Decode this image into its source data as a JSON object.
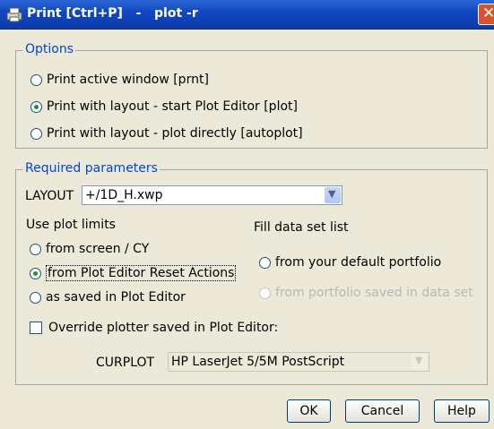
{
  "window": {
    "title": "Print [Ctrl+P]   -   plot -r",
    "icon": "print-icon",
    "close_icon": "close-icon"
  },
  "options": {
    "legend": "Options",
    "items": [
      {
        "label": "Print active window [prnt]",
        "checked": false
      },
      {
        "label": "Print with layout - start Plot Editor [plot]",
        "checked": true
      },
      {
        "label": "Print with layout - plot directly [autoplot]",
        "checked": false
      }
    ]
  },
  "required": {
    "legend": "Required parameters",
    "layout_label": "LAYOUT",
    "layout_value": "+/1D_H.xwp",
    "plot_limits_label": "Use plot limits",
    "plot_limits": [
      {
        "label": "from screen / CY",
        "checked": false
      },
      {
        "label": "from Plot Editor Reset Actions",
        "checked": true
      },
      {
        "label": "as saved in Plot Editor",
        "checked": false
      }
    ],
    "fill_label": "Fill data set list",
    "fill_options": [
      {
        "label": "from your default portfolio",
        "checked": false,
        "disabled": false
      },
      {
        "label": "from portfolio saved in data set",
        "checked": false,
        "disabled": true
      }
    ],
    "override_label": "Override plotter saved in Plot Editor:",
    "override_checked": false,
    "curplot_label": "CURPLOT",
    "curplot_value": "HP LaserJet 5/5M PostScript"
  },
  "buttons": {
    "ok": "OK",
    "cancel": "Cancel",
    "help": "Help"
  },
  "colors": {
    "title_bar": "#1248c2",
    "legend_text": "#0046d5",
    "dialog_bg": "#ece9d8"
  }
}
